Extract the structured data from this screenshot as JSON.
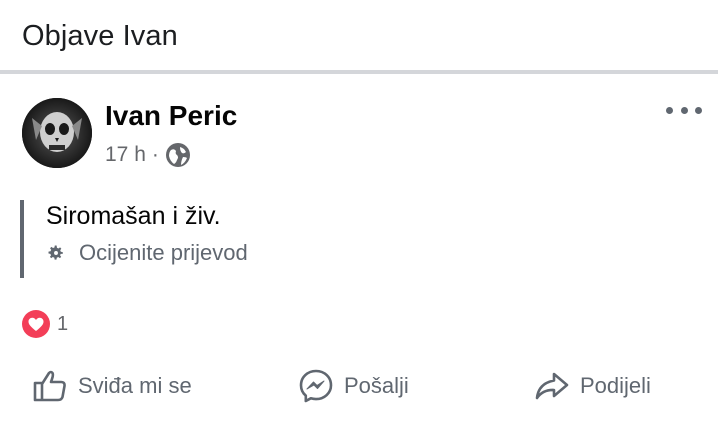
{
  "header": {
    "title": "Objave Ivan"
  },
  "post": {
    "author": "Ivan Peric",
    "time": "17 h",
    "separator": "·",
    "privacy_icon": "globe-icon",
    "text": "Siromašan i živ.",
    "translate_label": "Ocijenite prijevod",
    "reaction_icon": "love-icon",
    "reaction_count": "1",
    "menu_icon": "more-icon"
  },
  "actions": {
    "like_label": "Sviđa mi se",
    "send_label": "Pošalji",
    "share_label": "Podijeli"
  },
  "colors": {
    "love": "#f33e58",
    "muted_text": "#65676b",
    "divider": "#d4d6da"
  }
}
